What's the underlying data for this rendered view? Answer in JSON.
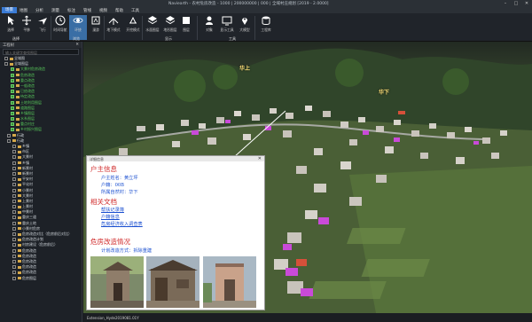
{
  "window": {
    "title": "Naviearth - 农村危房改造 - 1000 | 200000000 | 000 | 全域村庄规划 [2019 - 2.0000]",
    "min": "–",
    "max": "□",
    "close": "✕"
  },
  "menu": [
    "场景",
    "地图",
    "分析",
    "测量",
    "标注",
    "管线",
    "视频",
    "帮助",
    "工具"
  ],
  "ribbon": {
    "tools": [
      {
        "label": "选择",
        "icon": "pointer-icon"
      },
      {
        "label": "平移",
        "icon": "pan-icon"
      },
      {
        "label": "飞行",
        "icon": "fly-icon"
      },
      {
        "label": "时间导航",
        "icon": "clock-icon"
      },
      {
        "label": "环绕",
        "icon": "orbit-icon"
      },
      {
        "label": "漫游",
        "icon": "walk-icon"
      },
      {
        "label": "地下模式",
        "icon": "underground-icon"
      },
      {
        "label": "开挖模式",
        "icon": "dig-icon"
      },
      {
        "label": "水面图层",
        "icon": "layers-icon"
      },
      {
        "label": "地形图层",
        "icon": "layers-icon-2"
      },
      {
        "label": "图层",
        "icon": "layer-icon"
      },
      {
        "label": "对象",
        "icon": "object-icon"
      },
      {
        "label": "显示工具",
        "icon": "display-icon"
      },
      {
        "label": "大模型",
        "icon": "pin-icon"
      },
      {
        "label": "工程库",
        "icon": "database-icon"
      }
    ],
    "groups": [
      "选择",
      "浏览",
      "显示",
      "工具"
    ]
  },
  "panel": {
    "header": "工程树",
    "close": "✕",
    "search_placeholder": "输入关键字查找图层",
    "tree": [
      {
        "label": "全域图",
        "checked": false,
        "green": false
      },
      {
        "label": "全域图层",
        "checked": false,
        "green": false
      },
      {
        "label": "大景村危房改造",
        "checked": true,
        "green": true
      },
      {
        "label": "危房改造",
        "checked": true,
        "green": true
      },
      {
        "label": "重点改造",
        "checked": true,
        "green": true
      },
      {
        "label": "一般改造",
        "checked": true,
        "green": true
      },
      {
        "label": "已经改造",
        "checked": true,
        "green": true
      },
      {
        "label": "待定改造",
        "checked": true,
        "green": true
      },
      {
        "label": "土地利用图层",
        "checked": true,
        "green": true
      },
      {
        "label": "道路图层",
        "checked": true,
        "green": true
      },
      {
        "label": "乡镇图层",
        "checked": true,
        "green": true
      },
      {
        "label": "水系图层",
        "checked": true,
        "green": true
      },
      {
        "label": "重点村庄",
        "checked": true,
        "green": true
      },
      {
        "label": "乡村振兴图层",
        "checked": true,
        "green": true
      },
      {
        "label": "行政",
        "checked": false,
        "green": false
      },
      {
        "label": "行政",
        "checked": false,
        "green": false
      },
      {
        "label": "乡镇",
        "checked": false,
        "green": false
      },
      {
        "label": "市区",
        "checked": false,
        "green": false
      },
      {
        "label": "大景村",
        "checked": false,
        "green": false
      },
      {
        "label": "乡镇",
        "checked": false,
        "green": false
      },
      {
        "label": "新景村",
        "checked": false,
        "green": false
      },
      {
        "label": "新景村",
        "checked": false,
        "green": false
      },
      {
        "label": "平安村",
        "checked": false,
        "green": false
      },
      {
        "label": "平化村",
        "checked": false,
        "green": false
      },
      {
        "label": "小景村",
        "checked": false,
        "green": false
      },
      {
        "label": "大景村",
        "checked": false,
        "green": false
      },
      {
        "label": "上景村",
        "checked": false,
        "green": false
      },
      {
        "label": "上景村",
        "checked": false,
        "green": false
      },
      {
        "label": "中景村",
        "checked": false,
        "green": false
      },
      {
        "label": "重庆三道",
        "checked": false,
        "green": false
      },
      {
        "label": "重庆土地",
        "checked": false,
        "green": false
      },
      {
        "label": "小景村危房",
        "checked": false,
        "green": false
      },
      {
        "label": "危房改造对比（危房前后对比）",
        "checked": false,
        "green": false
      },
      {
        "label": "危房改造计划",
        "checked": false,
        "green": false
      },
      {
        "label": "村房建设（危房前后）",
        "checked": false,
        "green": false
      },
      {
        "label": "危房改造",
        "checked": false,
        "green": false
      },
      {
        "label": "危房改造",
        "checked": false,
        "green": false
      },
      {
        "label": "危房改造",
        "checked": false,
        "green": false
      },
      {
        "label": "危房改造",
        "checked": false,
        "green": false
      },
      {
        "label": "危房改造",
        "checked": false,
        "green": false
      },
      {
        "label": "危房图层",
        "checked": false,
        "green": false
      }
    ]
  },
  "scene": {
    "labels": [
      "华上",
      "华下"
    ]
  },
  "popup": {
    "title": "详细信息",
    "close": "✕",
    "sec1": "户主信息",
    "owner": "户主姓名：黄立坪",
    "household": "户籍：00B",
    "village": "所属自然村：华下",
    "sec2": "相关文档",
    "doc1": "帮扶记录簿",
    "doc2": "户籍信息",
    "doc3": "危房经济收入调查表",
    "sec3": "危房改造情况",
    "plan": "计划改造方式：拆除重建"
  },
  "status": "Extension_Hyde2019081.01Y"
}
